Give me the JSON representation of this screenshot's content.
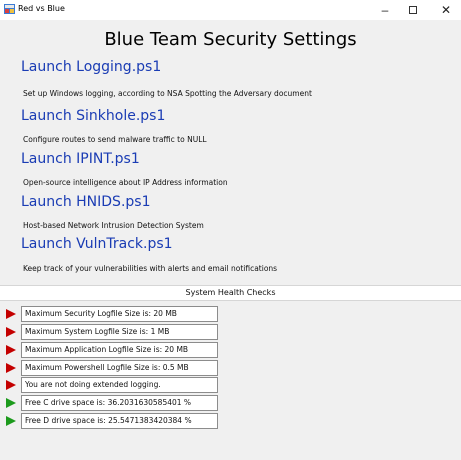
{
  "window": {
    "title": "Red vs Blue",
    "minimize_glyph": "–",
    "close_glyph": "✕"
  },
  "page": {
    "title": "Blue Team Security Settings"
  },
  "scripts": [
    {
      "label": "Launch Logging.ps1",
      "description": "Set up Windows logging, according to NSA Spotting the Adversary document"
    },
    {
      "label": "Launch Sinkhole.ps1",
      "description": "Configure routes to send malware traffic to NULL"
    },
    {
      "label": "Launch IPINT.ps1",
      "description": "Open-source intelligence about IP Address information"
    },
    {
      "label": "Launch HNIDS.ps1",
      "description": "Host-based Network Intrusion Detection System"
    },
    {
      "label": "Launch VulnTrack.ps1",
      "description": "Keep track of your vulnerabilities with alerts and email notifications"
    }
  ],
  "health": {
    "header": "System Health Checks",
    "checks": [
      {
        "text": "Maximum Security Logfile Size is: 20 MB",
        "status": "red"
      },
      {
        "text": "Maximum System Logfile Size is: 1 MB",
        "status": "red"
      },
      {
        "text": "Maximum Application Logfile Size is: 20 MB",
        "status": "red"
      },
      {
        "text": "Maximum Powershell Logfile Size is: 0.5 MB",
        "status": "red"
      },
      {
        "text": "You are not doing extended logging.",
        "status": "red"
      },
      {
        "text": "Free C drive space is: 36.2031630585401 %",
        "status": "green"
      },
      {
        "text": "Free D drive space is: 25.5471383420384 %",
        "status": "green"
      }
    ]
  },
  "colors": {
    "link": "#1a3cb4",
    "status_red": "#c40000",
    "status_green": "#1c9a1c"
  }
}
